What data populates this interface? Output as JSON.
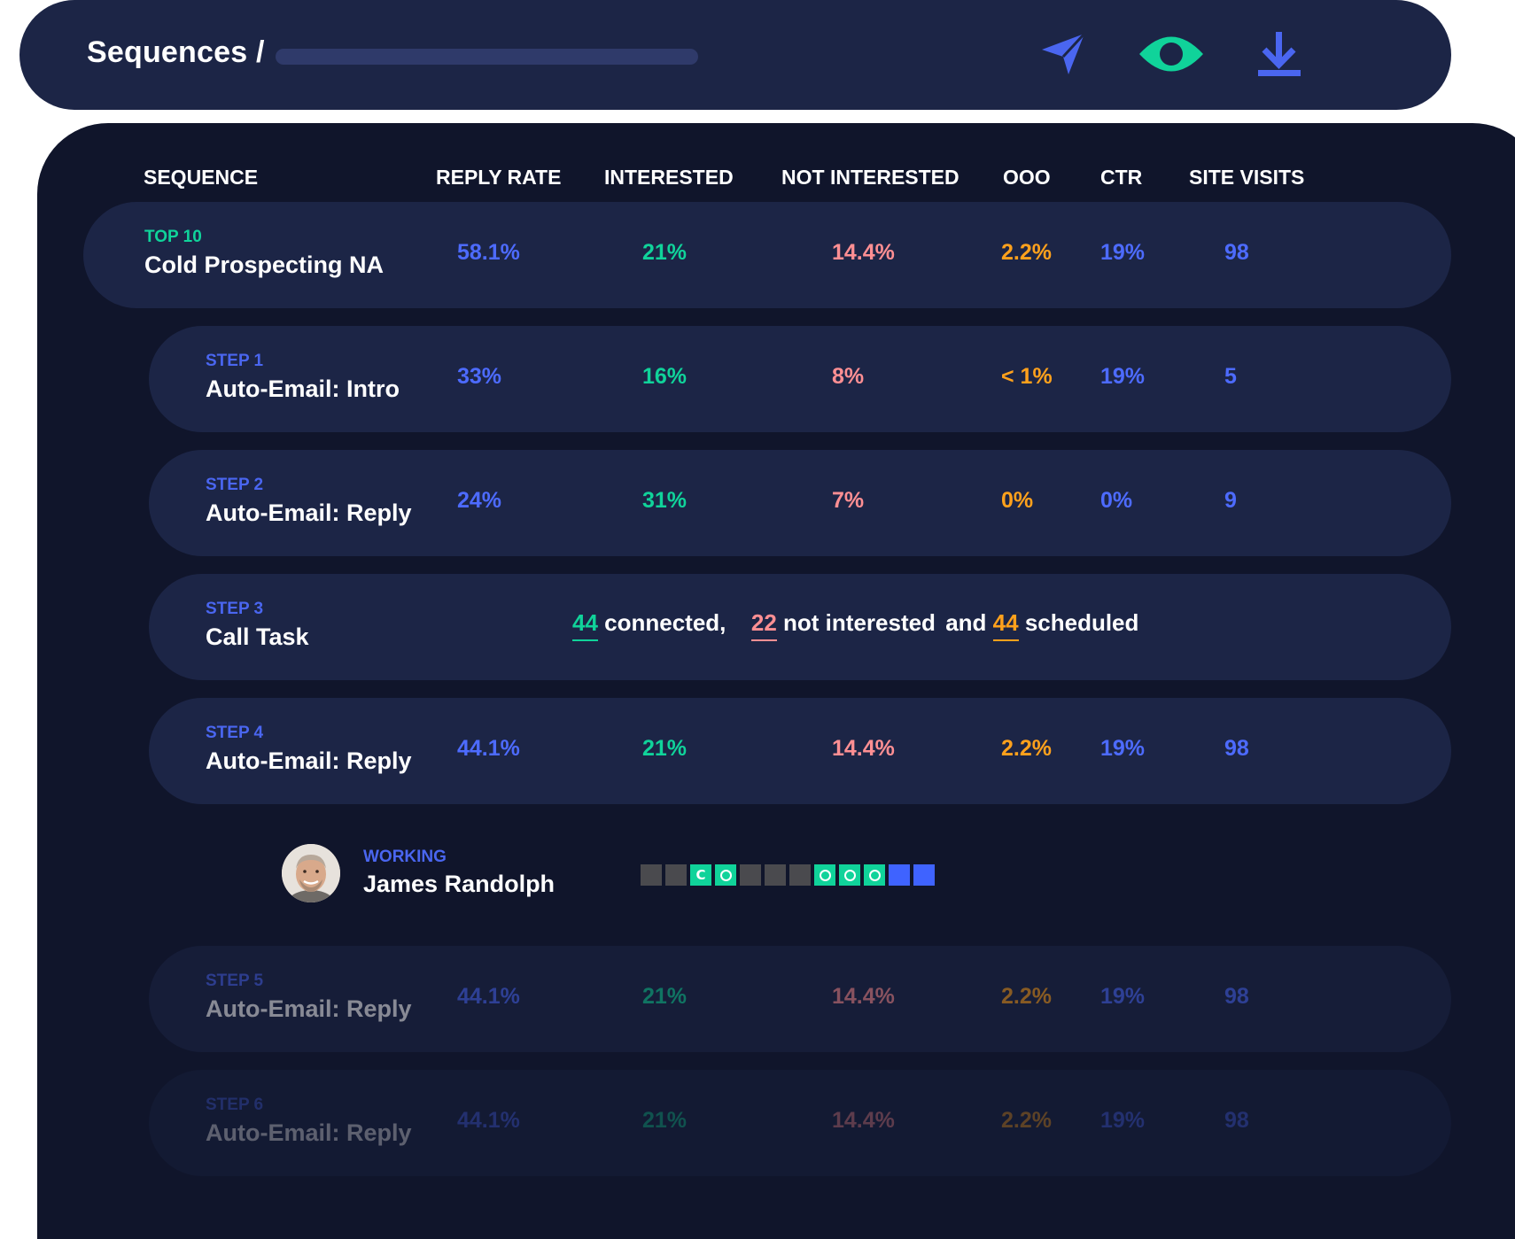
{
  "header": {
    "title": "Sequences /",
    "icons": [
      "send-icon",
      "eye-icon",
      "download-icon"
    ],
    "colors": {
      "send": "#4a66f0",
      "eye": "#10d39a",
      "download": "#4a66f0"
    }
  },
  "columns": [
    "SEQUENCE",
    "REPLY RATE",
    "INTERESTED",
    "NOT INTERESTED",
    "OOO",
    "CTR",
    "SITE VISITS"
  ],
  "colors": {
    "background": "#10152b",
    "row": "#1c2546",
    "reply_rate": "#4d6bff",
    "interested": "#10d39a",
    "not_interested": "#ff8f93",
    "ooo": "#ffa11c",
    "ctr": "#4d6bff",
    "site_visits": "#4d6bff"
  },
  "sequence": {
    "tag": "TOP 10",
    "name": "Cold Prospecting NA",
    "reply_rate": "58.1%",
    "interested": "21%",
    "not_interested": "14.4%",
    "ooo": "2.2%",
    "ctr": "19%",
    "site_visits": "98"
  },
  "steps": [
    {
      "label": "STEP 1",
      "name": "Auto-Email: Intro",
      "reply_rate": "33%",
      "interested": "16%",
      "not_interested": "8%",
      "ooo": "< 1%",
      "ctr": "19%",
      "site_visits": "5"
    },
    {
      "label": "STEP 2",
      "name": "Auto-Email: Reply",
      "reply_rate": "24%",
      "interested": "31%",
      "not_interested": "7%",
      "ooo": "0%",
      "ctr": "0%",
      "site_visits": "9"
    },
    {
      "label": "STEP 3",
      "name": "Call Task",
      "connected_count": "44",
      "connected_text": "connected,",
      "not_interested_count": "22",
      "not_interested_text": "not interested",
      "and_text": "and",
      "scheduled_count": "44",
      "scheduled_text": "scheduled"
    },
    {
      "label": "STEP 4",
      "name": "Auto-Email: Reply",
      "reply_rate": "44.1%",
      "interested": "21%",
      "not_interested": "14.4%",
      "ooo": "2.2%",
      "ctr": "19%",
      "site_visits": "98"
    },
    {
      "label": "STEP 5",
      "name": "Auto-Email: Reply",
      "reply_rate": "44.1%",
      "interested": "21%",
      "not_interested": "14.4%",
      "ooo": "2.2%",
      "ctr": "19%",
      "site_visits": "98"
    },
    {
      "label": "STEP 6",
      "name": "Auto-Email: Reply",
      "reply_rate": "44.1%",
      "interested": "21%",
      "not_interested": "14.4%",
      "ooo": "2.2%",
      "ctr": "19%",
      "site_visits": "98"
    }
  ],
  "working": {
    "status": "WORKING",
    "name": "James Randolph",
    "activity": [
      {
        "type": "gray",
        "glyph": ""
      },
      {
        "type": "gray",
        "glyph": ""
      },
      {
        "type": "green",
        "glyph": "C"
      },
      {
        "type": "green",
        "glyph": "ring"
      },
      {
        "type": "gray",
        "glyph": ""
      },
      {
        "type": "gray",
        "glyph": ""
      },
      {
        "type": "gray",
        "glyph": ""
      },
      {
        "type": "green",
        "glyph": "ring"
      },
      {
        "type": "green",
        "glyph": "ring"
      },
      {
        "type": "green",
        "glyph": "ring"
      },
      {
        "type": "blue",
        "glyph": ""
      },
      {
        "type": "blue",
        "glyph": ""
      }
    ]
  }
}
